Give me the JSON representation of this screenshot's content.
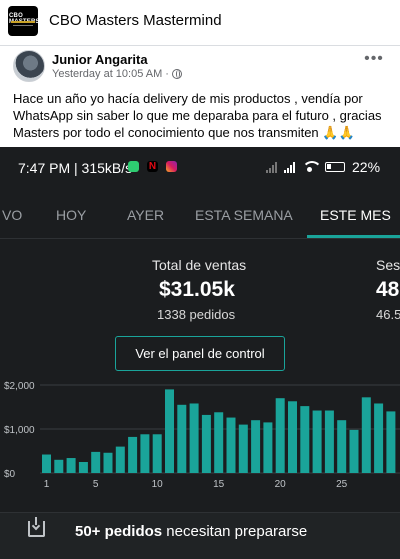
{
  "group": {
    "name": "CBO Masters Mastermind",
    "logo_text": "CBO MASTERS"
  },
  "post": {
    "author": "Junior Angarita",
    "timestamp": "Yesterday at 10:05 AM",
    "separator": "·",
    "text": "Hace un año yo hacía delivery de mis productos , vendía por WhatsApp sin saber lo que me deparaba para el futuro , gracias Masters por todo el conocimiento que nos transmiten 🙏🙏",
    "more_icon": "more-dots-icon"
  },
  "phone": {
    "status": {
      "time": "7:47 PM",
      "speed": "| 315kB/s",
      "battery": "22"
    },
    "tabs": [
      "VO",
      "HOY",
      "AYER",
      "ESTA SEMANA",
      "ESTE MES"
    ],
    "active_tab": "ESTE MES",
    "kpi_primary": {
      "label": "Total de ventas",
      "value": "$31.05k",
      "sub": "1338 pedidos"
    },
    "kpi_secondary": {
      "label": "Ses",
      "value": "48",
      "sub": "46.5"
    },
    "panel_button": "Ver el panel de control",
    "orders_bold": "50+ pedidos",
    "orders_rest": " necesitan prepararse",
    "colors": {
      "accent": "#1aa49a",
      "background": "#1b1d1f"
    }
  },
  "chart_data": {
    "type": "bar",
    "y_ticks": [
      "$2,000",
      "$1,000",
      "$0"
    ],
    "ylim": [
      0,
      2000
    ],
    "x_ticks": [
      "1",
      "5",
      "10",
      "15",
      "20",
      "25"
    ],
    "x": [
      1,
      2,
      3,
      4,
      5,
      6,
      7,
      8,
      9,
      10,
      11,
      12,
      13,
      14,
      15,
      16,
      17,
      18,
      19,
      20,
      21,
      22,
      23,
      24,
      25,
      26,
      27,
      28
    ],
    "values": [
      420,
      300,
      340,
      250,
      480,
      460,
      600,
      820,
      880,
      880,
      1900,
      1550,
      1580,
      1320,
      1380,
      1260,
      1100,
      1200,
      1150,
      1700,
      1630,
      1520,
      1420,
      1420,
      1200,
      980,
      1720,
      1580,
      1400
    ],
    "color": "#1aa49a",
    "grid": true
  }
}
